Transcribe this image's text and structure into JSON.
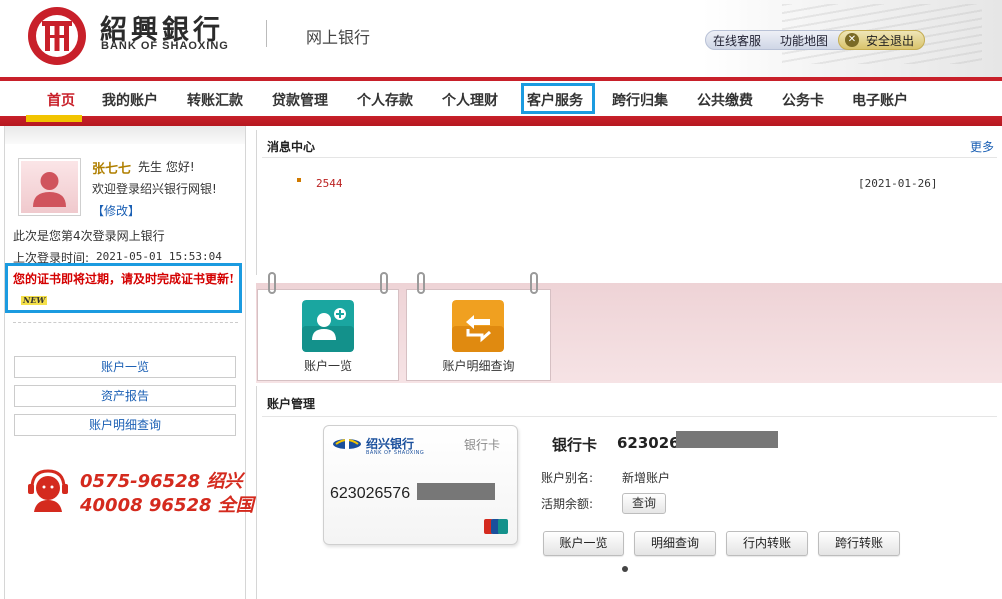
{
  "header": {
    "logo_cn": "紹興銀行",
    "logo_en": "BANK OF SHAOXING",
    "site_name": "网上银行",
    "util": {
      "service": "在线客服",
      "map": "功能地图",
      "logout": "安全退出"
    }
  },
  "nav": {
    "items": [
      "首页",
      "我的账户",
      "转账汇款",
      "贷款管理",
      "个人存款",
      "个人理财",
      "客户服务",
      "跨行归集",
      "公共缴费",
      "公务卡",
      "电子账户"
    ]
  },
  "user": {
    "name": "张七七",
    "title": "先生  您好!",
    "welcome": "欢迎登录绍兴银行网银!",
    "edit": "【修改】",
    "login_count": "此次是您第4次登录网上银行",
    "last_login_label": "上次登录时间:",
    "last_login_time": "2021-05-01 15:53:04",
    "cert_warning": "您的证书即将过期，请及时完成证书更新!",
    "new_badge": "NEW"
  },
  "quick_links": [
    "账户一览",
    "资产报告",
    "账户明细查询"
  ],
  "hotline": {
    "line1": "0575-96528 绍兴",
    "line2": "40008 96528 全国"
  },
  "messages": {
    "title": "消息中心",
    "more": "更多",
    "items": [
      {
        "text": "2544",
        "date": "[2021-01-26]"
      }
    ]
  },
  "shortcuts": [
    {
      "label": "账户一览",
      "icon": "user-add-icon",
      "color": "#1aa6a0"
    },
    {
      "label": "账户明细查询",
      "icon": "transfer-arrows-icon",
      "color": "#f0a020"
    }
  ],
  "account": {
    "title": "账户管理",
    "card_bank": "绍兴银行",
    "card_bank_en": "BANK OF SHAOXING",
    "card_type": "银行卡",
    "card_number": "623026576",
    "type_label": "银行卡",
    "number": "623026",
    "alias_label": "账户别名:",
    "alias_value": "新增账户",
    "balance_label": "活期余额:",
    "query_button": "查询",
    "actions": [
      "账户一览",
      "明细查询",
      "行内转账",
      "跨行转账"
    ]
  },
  "colors": {
    "brand_red": "#c8202a",
    "highlight_blue": "#1b9be0",
    "active_yellow": "#f2c400"
  }
}
